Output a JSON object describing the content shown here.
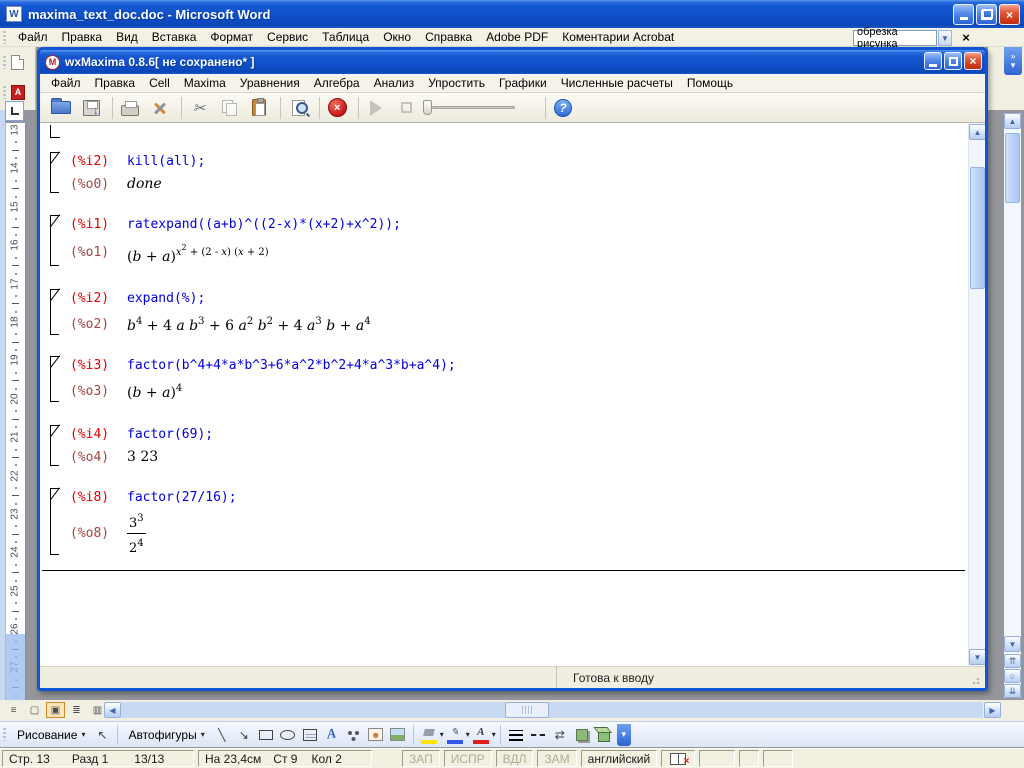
{
  "colors": {
    "title_blue": "#1053CC",
    "input_label_red": "#DF0000",
    "input_code_blue": "#0000DC",
    "output_label_maroon": "#A34444",
    "selection_orange": "#C88A28"
  },
  "word": {
    "title": "maxima_text_doc.doc - Microsoft Word",
    "menu": [
      "Файл",
      "Правка",
      "Вид",
      "Вставка",
      "Формат",
      "Сервис",
      "Таблица",
      "Окно",
      "Справка",
      "Adobe PDF",
      "Коментарии Acrobat"
    ],
    "question_box": "обрезка рисунка",
    "ruler_numbers": [
      "13",
      "14",
      "15",
      "16",
      "17",
      "18",
      "19",
      "20",
      "21",
      "22",
      "23",
      "24",
      "25",
      "26",
      "27"
    ],
    "drawing_toolbar": {
      "drawing_label": "Рисование",
      "autoshapes_label": "Автофигуры"
    },
    "status_bar": {
      "page": "Стр. 13",
      "section": "Разд 1",
      "page_of": "13/13",
      "position": "На 23,4см",
      "line": "Ст 9",
      "column": "Кол 2",
      "modes": [
        "ЗАП",
        "ИСПР",
        "ВДЛ",
        "ЗАМ"
      ],
      "language": "английский"
    }
  },
  "wxmaxima": {
    "title": "wxMaxima 0.8.6[ не сохранено* ]",
    "menu": [
      "Файл",
      "Правка",
      "Cell",
      "Maxima",
      "Уравнения",
      "Алгебра",
      "Анализ",
      "Упростить",
      "Графики",
      "Численные расчеты",
      "Помощь"
    ],
    "status": "Готова к вводу",
    "cells": [
      {
        "input_label": "(%i2)",
        "input_code": "kill(all);",
        "output_label": "(%o0)",
        "output": [
          [
            0,
            "v",
            "done"
          ]
        ]
      },
      {
        "input_label": "(%i1)",
        "input_code": "ratexpand((a+b)^((2-x)*(x+2)+x^2));",
        "output_label": "(%o1)",
        "output": [
          [
            0,
            "n",
            "("
          ],
          [
            0,
            "v",
            "b"
          ],
          [
            0,
            "n",
            " + "
          ],
          [
            0,
            "v",
            "a"
          ],
          [
            0,
            "n",
            ")"
          ],
          [
            1,
            "v",
            "x"
          ],
          [
            2,
            "n",
            "2"
          ],
          [
            1,
            "n",
            " + (2 - "
          ],
          [
            1,
            "v",
            "x"
          ],
          [
            1,
            "n",
            ") ("
          ],
          [
            1,
            "v",
            "x"
          ],
          [
            1,
            "n",
            " + 2)"
          ]
        ]
      },
      {
        "input_label": "(%i2)",
        "input_code": "expand(%);",
        "output_label": "(%o2)",
        "output": [
          [
            0,
            "v",
            "b"
          ],
          [
            1,
            "n",
            "4"
          ],
          [
            0,
            "n",
            " + 4 "
          ],
          [
            0,
            "v",
            "a"
          ],
          [
            0,
            "n",
            " "
          ],
          [
            0,
            "v",
            "b"
          ],
          [
            1,
            "n",
            "3"
          ],
          [
            0,
            "n",
            " + 6 "
          ],
          [
            0,
            "v",
            "a"
          ],
          [
            1,
            "n",
            "2"
          ],
          [
            0,
            "n",
            " "
          ],
          [
            0,
            "v",
            "b"
          ],
          [
            1,
            "n",
            "2"
          ],
          [
            0,
            "n",
            " + 4 "
          ],
          [
            0,
            "v",
            "a"
          ],
          [
            1,
            "n",
            "3"
          ],
          [
            0,
            "n",
            " "
          ],
          [
            0,
            "v",
            "b"
          ],
          [
            0,
            "n",
            " + "
          ],
          [
            0,
            "v",
            "a"
          ],
          [
            1,
            "n",
            "4"
          ]
        ]
      },
      {
        "input_label": "(%i3)",
        "input_code": "factor(b^4+4*a*b^3+6*a^2*b^2+4*a^3*b+a^4);",
        "output_label": "(%o3)",
        "output": [
          [
            0,
            "n",
            "("
          ],
          [
            0,
            "v",
            "b"
          ],
          [
            0,
            "n",
            " + "
          ],
          [
            0,
            "v",
            "a"
          ],
          [
            0,
            "n",
            ")"
          ],
          [
            1,
            "n",
            "4"
          ]
        ]
      },
      {
        "input_label": "(%i4)",
        "input_code": "factor(69);",
        "output_label": "(%o4)",
        "output": [
          [
            0,
            "n",
            "3 23"
          ]
        ]
      },
      {
        "input_label": "(%i8)",
        "input_code": "factor(27/16);",
        "output_label": "(%o8)",
        "output": [
          {
            "frac": {
              "num": [
                [
                  0,
                  "n",
                  "3"
                ],
                [
                  1,
                  "n",
                  "3"
                ]
              ],
              "den": [
                [
                  0,
                  "n",
                  "2"
                ],
                [
                  1,
                  "n",
                  "4"
                ]
              ]
            }
          }
        ]
      }
    ]
  }
}
